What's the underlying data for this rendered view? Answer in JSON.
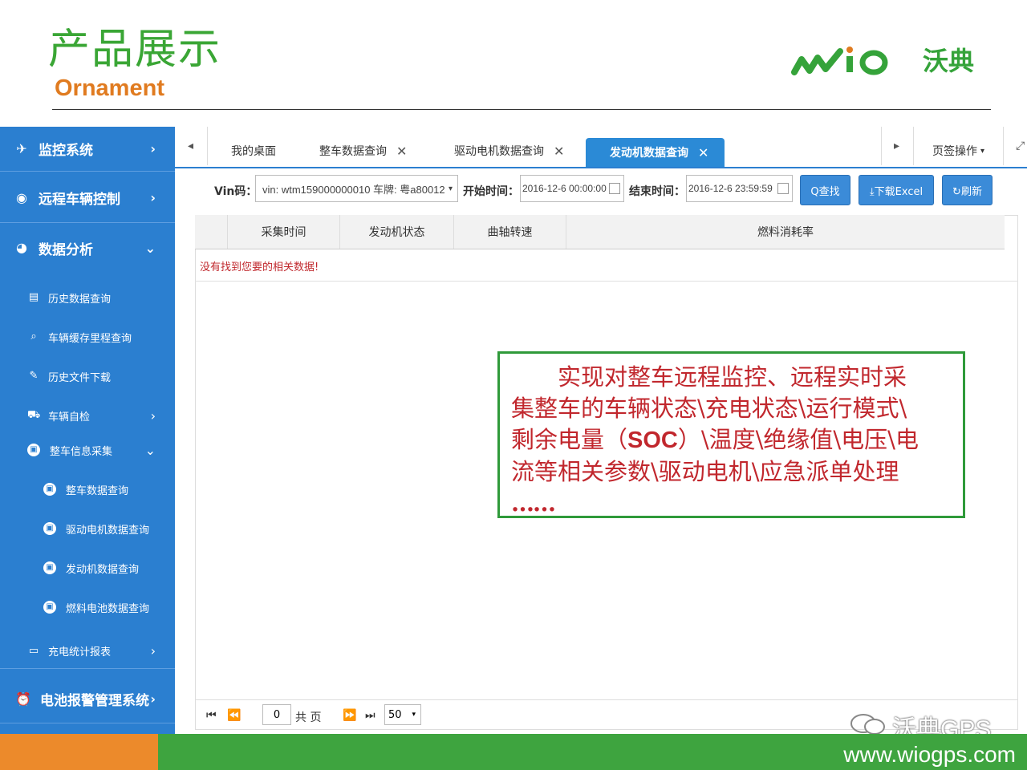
{
  "slide": {
    "title": "产品展示",
    "subtitle": "Ornament",
    "logo_text": "沃典",
    "footer_url": "www.wiogps.com",
    "watermark": "沃典GPS"
  },
  "sidebar": {
    "items": [
      {
        "label": "监控系统",
        "icon": "satellite-icon"
      },
      {
        "label": "远程车辆控制",
        "icon": "remote-icon"
      },
      {
        "label": "数据分析",
        "icon": "pie-chart-icon"
      },
      {
        "label": "历史数据查询",
        "icon": "document-icon"
      },
      {
        "label": "车辆缓存里程查询",
        "icon": "search-icon"
      },
      {
        "label": "历史文件下载",
        "icon": "download-icon"
      },
      {
        "label": "车辆自检",
        "icon": "car-check-icon"
      },
      {
        "label": "整车信息采集",
        "icon": "car-icon"
      },
      {
        "label": "整车数据查询",
        "icon": "car-icon"
      },
      {
        "label": "驱动电机数据查询",
        "icon": "car-icon"
      },
      {
        "label": "发动机数据查询",
        "icon": "car-icon"
      },
      {
        "label": "燃料电池数据查询",
        "icon": "car-icon"
      },
      {
        "label": "充电统计报表",
        "icon": "monitor-icon"
      },
      {
        "label": "电池报警管理系统",
        "icon": "alarm-icon"
      }
    ]
  },
  "tabs": {
    "items": [
      "我的桌面",
      "整车数据查询",
      "驱动电机数据查询",
      "发动机数据查询"
    ],
    "page_ops": "页签操作"
  },
  "filter": {
    "vin_label": "Vin码：",
    "vin_value": "vin: wtm159000000010 车牌: 粤a80012",
    "start_label": "开始时间：",
    "start_value": "2016-12-6 00:00:00",
    "end_label": "结束时间：",
    "end_value": "2016-12-6 23:59:59",
    "search_btn": "Q查找",
    "excel_btn": "⤓下载Excel",
    "refresh_btn": "↻刷新"
  },
  "grid": {
    "columns": [
      "采集时间",
      "发动机状态",
      "曲轴转速",
      "燃料消耗率"
    ],
    "empty_message": "没有找到您要的相关数据!"
  },
  "note": {
    "lines": [
      "　　实现对整车远程监控、远程实时采",
      "集整车的车辆状态\\充电状态\\运行模式\\",
      "剩余电量（",
      "SOC",
      "）\\温度\\绝缘值\\电压\\电",
      "流等相关参数\\驱动电机\\应急派单处理",
      "……"
    ]
  },
  "pager": {
    "page": "0",
    "total_label": "共 页",
    "page_size": "50"
  },
  "colors": {
    "sidebar": "#2b7fd0",
    "title_green": "#3aa635",
    "subtitle_orange": "#e07b20",
    "note_text": "#c1272d",
    "note_border": "#2f9a3a"
  }
}
